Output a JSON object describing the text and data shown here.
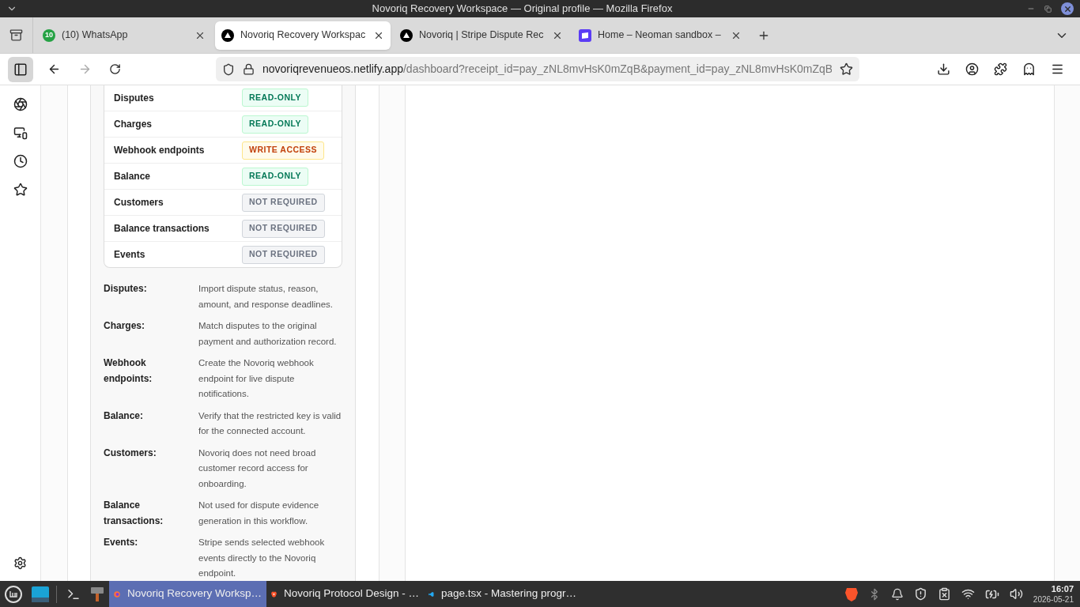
{
  "window": {
    "title": "Novoriq Recovery Workspace — Original profile — Mozilla Firefox"
  },
  "tabs": [
    {
      "label": "(10) WhatsApp",
      "badge": "10",
      "selected": false
    },
    {
      "label": "Novoriq Recovery Workspac",
      "selected": true
    },
    {
      "label": "Novoriq | Stripe Dispute Rec",
      "selected": false
    },
    {
      "label": "Home – Neoman sandbox –",
      "selected": false
    }
  ],
  "address_bar": {
    "host": "novoriqrevenueos.netlify.app",
    "path": "/dashboard?receipt_id=pay_zNL8mvHsK0mZqB&payment_id=pay_zNL8mvHsK0mZqB"
  },
  "sidebar": {
    "items": [
      {
        "kind": "panel",
        "selected": true
      },
      {
        "kind": "chat",
        "selected": false
      },
      {
        "kind": "devices",
        "selected": false
      },
      {
        "kind": "history",
        "selected": false
      },
      {
        "kind": "bookmarks",
        "selected": false
      }
    ]
  },
  "permissions": [
    {
      "name": "Disputes",
      "access": "READ-ONLY",
      "kind": "read"
    },
    {
      "name": "Charges",
      "access": "READ-ONLY",
      "kind": "read"
    },
    {
      "name": "Webhook endpoints",
      "access": "WRITE ACCESS",
      "kind": "write"
    },
    {
      "name": "Balance",
      "access": "READ-ONLY",
      "kind": "read"
    },
    {
      "name": "Customers",
      "access": "NOT REQUIRED",
      "kind": "none"
    },
    {
      "name": "Balance transactions",
      "access": "NOT REQUIRED",
      "kind": "none"
    },
    {
      "name": "Events",
      "access": "NOT REQUIRED",
      "kind": "none"
    }
  ],
  "descriptions": [
    {
      "term": "Disputes:",
      "text": "Import dispute status, reason, amount, and response deadlines."
    },
    {
      "term": "Charges:",
      "text": "Match disputes to the original payment and authorization record."
    },
    {
      "term": "Webhook endpoints:",
      "text": "Create the Novoriq webhook endpoint for live dispute notifications."
    },
    {
      "term": "Balance:",
      "text": "Verify that the restricted key is valid for the connected account."
    },
    {
      "term": "Customers:",
      "text": "Novoriq does not need broad customer record access for onboarding."
    },
    {
      "term": "Balance transactions:",
      "text": "Not used for dispute evidence generation in this workflow."
    },
    {
      "term": "Events:",
      "text": "Stripe sends selected webhook events directly to the Novoriq endpoint."
    }
  ],
  "taskbar": {
    "windows": [
      {
        "label": "Novoriq Recovery Worksp…",
        "selected": true
      },
      {
        "label": "Novoriq Protocol Design - …",
        "selected": false
      },
      {
        "label": "page.tsx - Mastering progr…",
        "selected": false
      }
    ],
    "time": "16:07",
    "date": "2026-05-21"
  }
}
